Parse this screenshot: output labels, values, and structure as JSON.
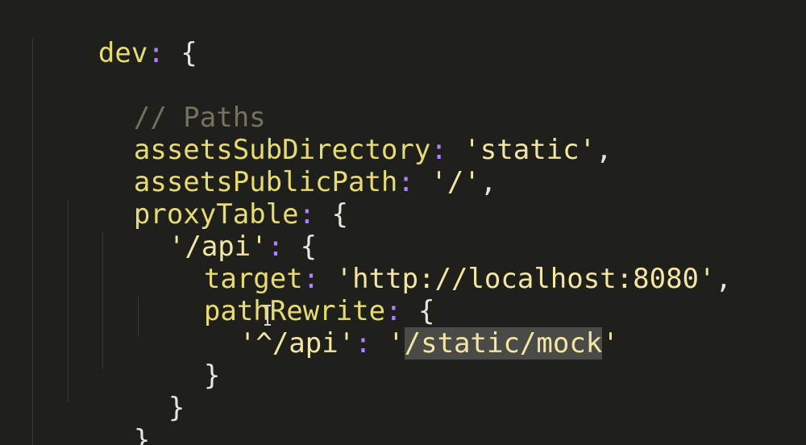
{
  "editor": {
    "theme_colors": {
      "background": "#1f201c",
      "property": "#e6db74",
      "colon": "#ae81ff",
      "string": "#f2e5a6",
      "comment": "#75715e",
      "selection": "#4a4a46"
    },
    "lines": [
      {
        "key": "dev",
        "colon": ":",
        "rest": " {"
      },
      {
        "comment": "// Paths"
      },
      {
        "key": "assetsSubDirectory",
        "colon": ":",
        "value": "'static'",
        "rest": ","
      },
      {
        "key": "assetsPublicPath",
        "colon": ":",
        "value": "'/'",
        "rest": ","
      },
      {
        "key": "proxyTable",
        "colon": ":",
        "rest": " {"
      },
      {
        "key": "'/api'",
        "colon": ":",
        "rest": " {"
      },
      {
        "key": "target",
        "colon": ":",
        "value": "'http://localhost:8080'",
        "rest": ","
      },
      {
        "key": "pathRewrite",
        "colon": ":",
        "rest": " {"
      },
      {
        "key": "'^/api'",
        "colon": ":",
        "value_pre": "'",
        "value_selected": "/static/mock",
        "value_post": "'"
      },
      {
        "text": "}"
      },
      {
        "text": "}"
      },
      {
        "text": "},"
      }
    ]
  }
}
